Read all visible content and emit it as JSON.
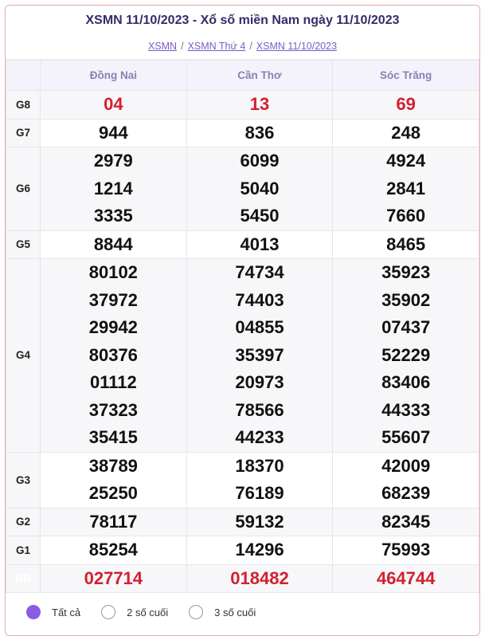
{
  "header": {
    "title": "XSMN 11/10/2023 - Xổ số miền Nam ngày 11/10/2023",
    "breadcrumbs": [
      "XSMN",
      "XSMN Thứ 4",
      "XSMN 11/10/2023"
    ]
  },
  "table": {
    "columns": [
      "Đồng Nai",
      "Cần Thơ",
      "Sóc Trăng"
    ],
    "rows": [
      {
        "label": "G8",
        "values": [
          [
            "04"
          ],
          [
            "13"
          ],
          [
            "69"
          ]
        ]
      },
      {
        "label": "G7",
        "values": [
          [
            "944"
          ],
          [
            "836"
          ],
          [
            "248"
          ]
        ]
      },
      {
        "label": "G6",
        "values": [
          [
            "2979",
            "1214",
            "3335"
          ],
          [
            "6099",
            "5040",
            "5450"
          ],
          [
            "4924",
            "2841",
            "7660"
          ]
        ]
      },
      {
        "label": "G5",
        "values": [
          [
            "8844"
          ],
          [
            "4013"
          ],
          [
            "8465"
          ]
        ]
      },
      {
        "label": "G4",
        "values": [
          [
            "80102",
            "37972",
            "29942",
            "80376",
            "01112",
            "37323",
            "35415"
          ],
          [
            "74734",
            "74403",
            "04855",
            "35397",
            "20973",
            "78566",
            "44233"
          ],
          [
            "35923",
            "35902",
            "07437",
            "52229",
            "83406",
            "44333",
            "55607"
          ]
        ]
      },
      {
        "label": "G3",
        "values": [
          [
            "38789",
            "25250"
          ],
          [
            "18370",
            "76189"
          ],
          [
            "42009",
            "68239"
          ]
        ]
      },
      {
        "label": "G2",
        "values": [
          [
            "78117"
          ],
          [
            "59132"
          ],
          [
            "82345"
          ]
        ]
      },
      {
        "label": "G1",
        "values": [
          [
            "85254"
          ],
          [
            "14296"
          ],
          [
            "75993"
          ]
        ]
      },
      {
        "label": "ĐB",
        "values": [
          [
            "027714"
          ],
          [
            "018482"
          ],
          [
            "464744"
          ]
        ]
      }
    ]
  },
  "filters": {
    "options": [
      "Tất cả",
      "2 số cuối",
      "3 số cuối"
    ],
    "selected": "Tất cả"
  },
  "colors": {
    "accent": "#8b5be3",
    "prize_red": "#d3202f",
    "special_label_bg": "#e23d4d"
  }
}
